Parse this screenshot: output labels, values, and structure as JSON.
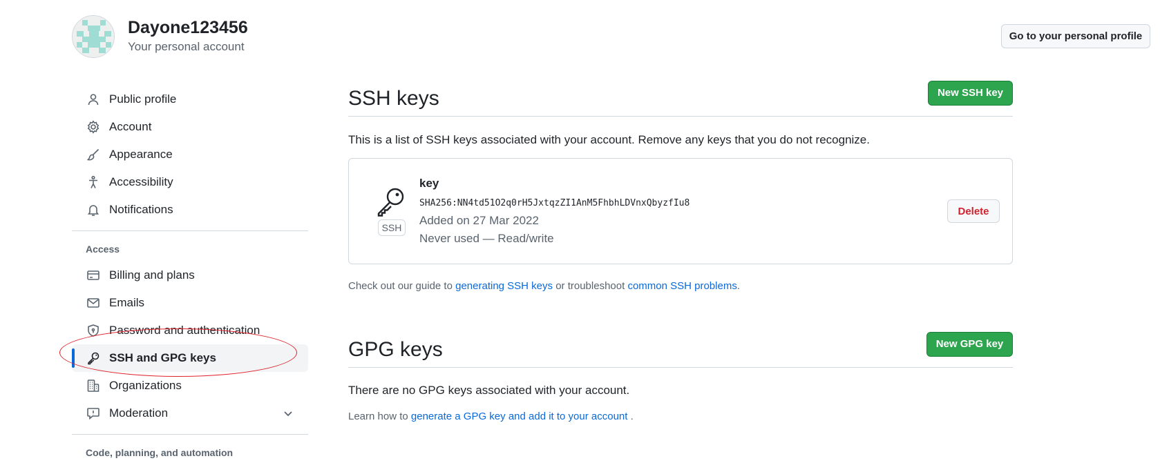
{
  "header": {
    "username": "Dayone123456",
    "subtitle": "Your personal account",
    "profile_button": "Go to your personal profile"
  },
  "sidebar": {
    "items": [
      {
        "label": "Public profile",
        "icon": "person-icon"
      },
      {
        "label": "Account",
        "icon": "gear-icon"
      },
      {
        "label": "Appearance",
        "icon": "paintbrush-icon"
      },
      {
        "label": "Accessibility",
        "icon": "accessibility-icon"
      },
      {
        "label": "Notifications",
        "icon": "bell-icon"
      }
    ],
    "access_label": "Access",
    "access_items": [
      {
        "label": "Billing and plans",
        "icon": "credit-card-icon"
      },
      {
        "label": "Emails",
        "icon": "mail-icon"
      },
      {
        "label": "Password and authentication",
        "icon": "shield-lock-icon"
      },
      {
        "label": "SSH and GPG keys",
        "icon": "key-icon",
        "active": true
      },
      {
        "label": "Organizations",
        "icon": "organization-icon"
      },
      {
        "label": "Moderation",
        "icon": "report-icon"
      }
    ],
    "code_label": "Code, planning, and automation"
  },
  "ssh": {
    "title": "SSH keys",
    "new_button": "New SSH key",
    "description": "This is a list of SSH keys associated with your account. Remove any keys that you do not recognize.",
    "key": {
      "badge": "SSH",
      "name": "key",
      "fingerprint": "SHA256:NN4td51O2q0rH5JxtqzZI1AnM5FhbhLDVnxQbyzfIu8",
      "added": "Added on 27 Mar 2022",
      "usage": "Never used — Read/write",
      "delete_label": "Delete"
    },
    "guide_prefix": "Check out our guide to ",
    "guide_link": "generating SSH keys",
    "guide_middle": " or troubleshoot ",
    "guide_link2": "common SSH problems",
    "guide_suffix": "."
  },
  "gpg": {
    "title": "GPG keys",
    "new_button": "New GPG key",
    "empty_text": "There are no GPG keys associated with your account.",
    "learn_prefix": "Learn how to ",
    "learn_link": "generate a GPG key and add it to your account",
    "learn_suffix": " ."
  },
  "colors": {
    "accent": "#0969da",
    "green": "#2da44e",
    "danger": "#cf222e",
    "annotation": "#e0202a"
  }
}
